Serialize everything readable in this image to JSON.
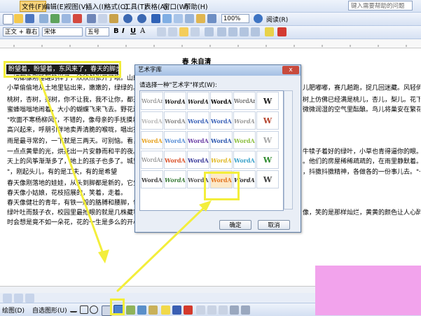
{
  "menu": {
    "items": [
      "文件(F)",
      "编辑(E)",
      "视图(V)",
      "插入(I)",
      "格式(O)",
      "工具(T)",
      "表格(A)",
      "窗口(W)",
      "帮助(H)"
    ],
    "help_placeholder": "键入需要帮助的问题"
  },
  "toolbar": {
    "zoom": "100%",
    "read_label": "阅读(R)"
  },
  "format_bar": {
    "style": "正文 + 靠右",
    "font": "宋体",
    "size": "五号",
    "bold": "B",
    "italic": "I",
    "underline": "U",
    "char_a": "A"
  },
  "document": {
    "title": "春 朱自清",
    "selected_text": "盼望着，盼望着，东风来了，春天的脚步近了。",
    "lines": [
      "一切都像刚睡醒的样子，欣欣然张开了眼。山朗润起来",
      "小草偷偷地从土地里钻出来，嫩嫩的，绿绿的。园子",
      "桃树，杏树，梨树，你不让我，我不让你，都开满了",
      "蜜蜂嗡嗡地闹着，大小的蝴蝶飞来飞去。野花遍地是：杂",
      "\"吹面不寒杨柳风\"，不错的，像母亲的手抚摸着你。",
      "高兴起来，呼朋引伴地卖弄清脆的喉咙，唱出宛转的曲子",
      "雨是最寻常的，一下就是三两天。可别恼。看，像牛",
      "一点点黄晕的光，烘托出一片安静而和平的夜。乡下",
      "天上的风筝渐渐多了，地上的孩子也多了。城里乡下，",
      "\"，刚起头儿，有的是工夫，有的是希望",
      "春天像刚落地的娃娃，从头到脚都是新的，它生长着",
      "春天像小姑娘，花枝招展的，笑着，走着。",
      "春天像健壮的青年，有铁一般的胳膊和腰脚，领着我",
      "绿叶吐而鼓子衣，校园里最抢眼的就是几株藏客",
      "时会想是竟不如一朵花，花的一生是多么的开心，西人的"
    ],
    "right_lines": [
      "儿肥嘟嘟，赛几趟跑，捉几回迷藏。风轻俏俏的，草软绵",
      "树上仿佛已经满是桃儿，杏儿，梨儿。花下成千成百的",
      "微微润湿的空气里酝酿。鸟儿将巢安在繁花嫩叶当中，",
      "牛犊子着好的绿叶，小草也青得逼你的眼。傍晚时候，上灯",
      "。他们的房屋稀稀疏疏的，在雨里静默着。",
      "，抖擞抖擞精神，各做各的一份事儿去。\"一年之计在于",
      "",
      "像，笑的是那样灿烂，黄黄的颜色让人心醉，有"
    ]
  },
  "dialog": {
    "title": "艺术字库",
    "prompt": "请选择一种\"艺术字\"样式(W):",
    "ok_label": "确定",
    "cancel_label": "取消",
    "close_glyph": "x",
    "styles": [
      "WordArt",
      "WordArt",
      "WordArt",
      "WordArt",
      "WordArt",
      "W",
      "WordArt",
      "WordArt",
      "WordArt",
      "WordArt",
      "WordArt",
      "W",
      "WordArt",
      "WordArt",
      "WordArt",
      "WordArt",
      "WordArt",
      "W",
      "WordArt",
      "WordArt",
      "WordArt",
      "WordArt",
      "WordArt",
      "W",
      "WordArt",
      "WordArt",
      "WordArt",
      "WordArt",
      "WordArt",
      "W"
    ]
  },
  "drawbar": {
    "draw_label": "绘图(D)",
    "autoshape_label": "自选图形(U)"
  },
  "colors": {
    "highlight": "#f3ee3b",
    "pink_box": "#f2a3ec",
    "selected_text_bg": "#1b1b1b"
  }
}
